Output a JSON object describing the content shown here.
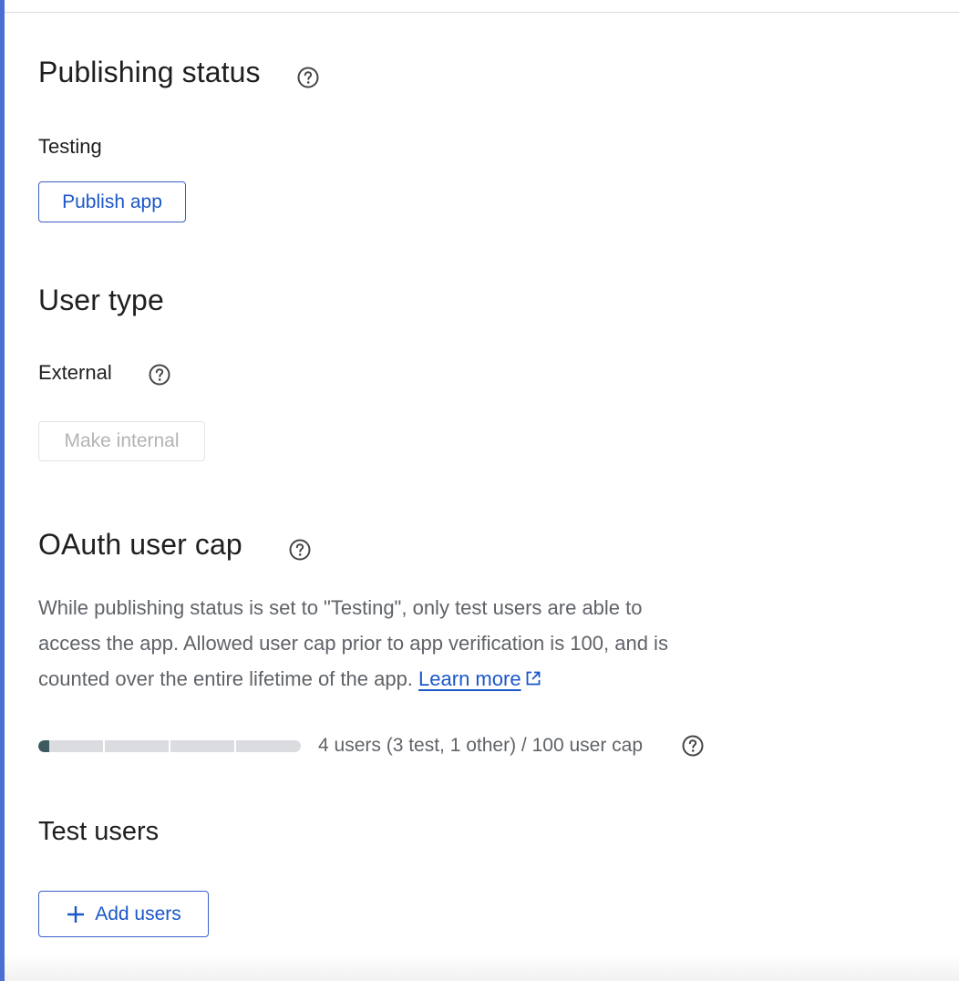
{
  "publishing": {
    "title": "Publishing status",
    "status_value": "Testing",
    "publish_button": "Publish app"
  },
  "user_type": {
    "title": "User type",
    "value": "External",
    "make_internal_button": "Make internal"
  },
  "oauth_cap": {
    "title": "OAuth user cap",
    "description_line1": "While publishing status is set to \"Testing\", only test users are able to",
    "description_line2": "access the app. Allowed user cap prior to app verification is 100, and is",
    "description_line3": "counted over the entire lifetime of the app.",
    "learn_more": "Learn more",
    "usage_text": "4 users (3 test, 1 other) / 100 user cap",
    "used_users": 4,
    "user_cap": 100
  },
  "test_users": {
    "title": "Test users",
    "add_button": "Add users"
  },
  "icons": {
    "help": "help-circle-icon",
    "external_link": "open-in-new-icon",
    "add": "plus-icon"
  },
  "colors": {
    "accent": "#1a57c8",
    "left_border": "#4a6fd2",
    "bar_fill": "#3c5a5f",
    "bar_track": "#dadce0"
  }
}
